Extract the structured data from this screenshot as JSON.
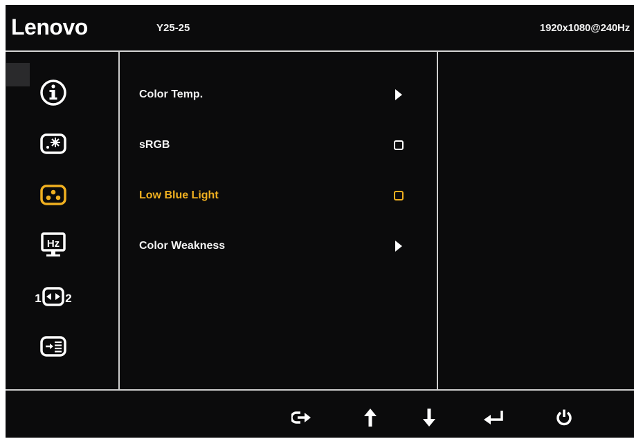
{
  "header": {
    "brand": "Lenovo",
    "model": "Y25-25",
    "resolution": "1920x1080@240Hz"
  },
  "sidebar": {
    "icons": [
      {
        "name": "information-icon",
        "active": false
      },
      {
        "name": "brightness-icon",
        "active": false
      },
      {
        "name": "color-settings-icon",
        "active": true
      },
      {
        "name": "refresh-rate-icon",
        "active": false
      },
      {
        "name": "input-signal-icon",
        "active": false
      },
      {
        "name": "menu-settings-icon",
        "active": false
      }
    ],
    "icon_labels": {
      "refresh": "Hz",
      "input_left": "1",
      "input_right": "2"
    }
  },
  "menu": {
    "items": [
      {
        "label": "Color Temp.",
        "control": "arrow"
      },
      {
        "label": "sRGB",
        "control": "checkbox"
      },
      {
        "label": "Low Blue Light",
        "control": "checkbox",
        "active": true
      },
      {
        "label": "Color Weakness",
        "control": "arrow"
      }
    ]
  },
  "footer": {
    "buttons": [
      "exit-icon",
      "up-arrow-icon",
      "down-arrow-icon",
      "enter-icon",
      "power-icon"
    ]
  },
  "colors": {
    "background": "#0b0b0c",
    "text": "#f2f2f2",
    "accent": "#f0b020",
    "divider": "#cfcfcf"
  }
}
